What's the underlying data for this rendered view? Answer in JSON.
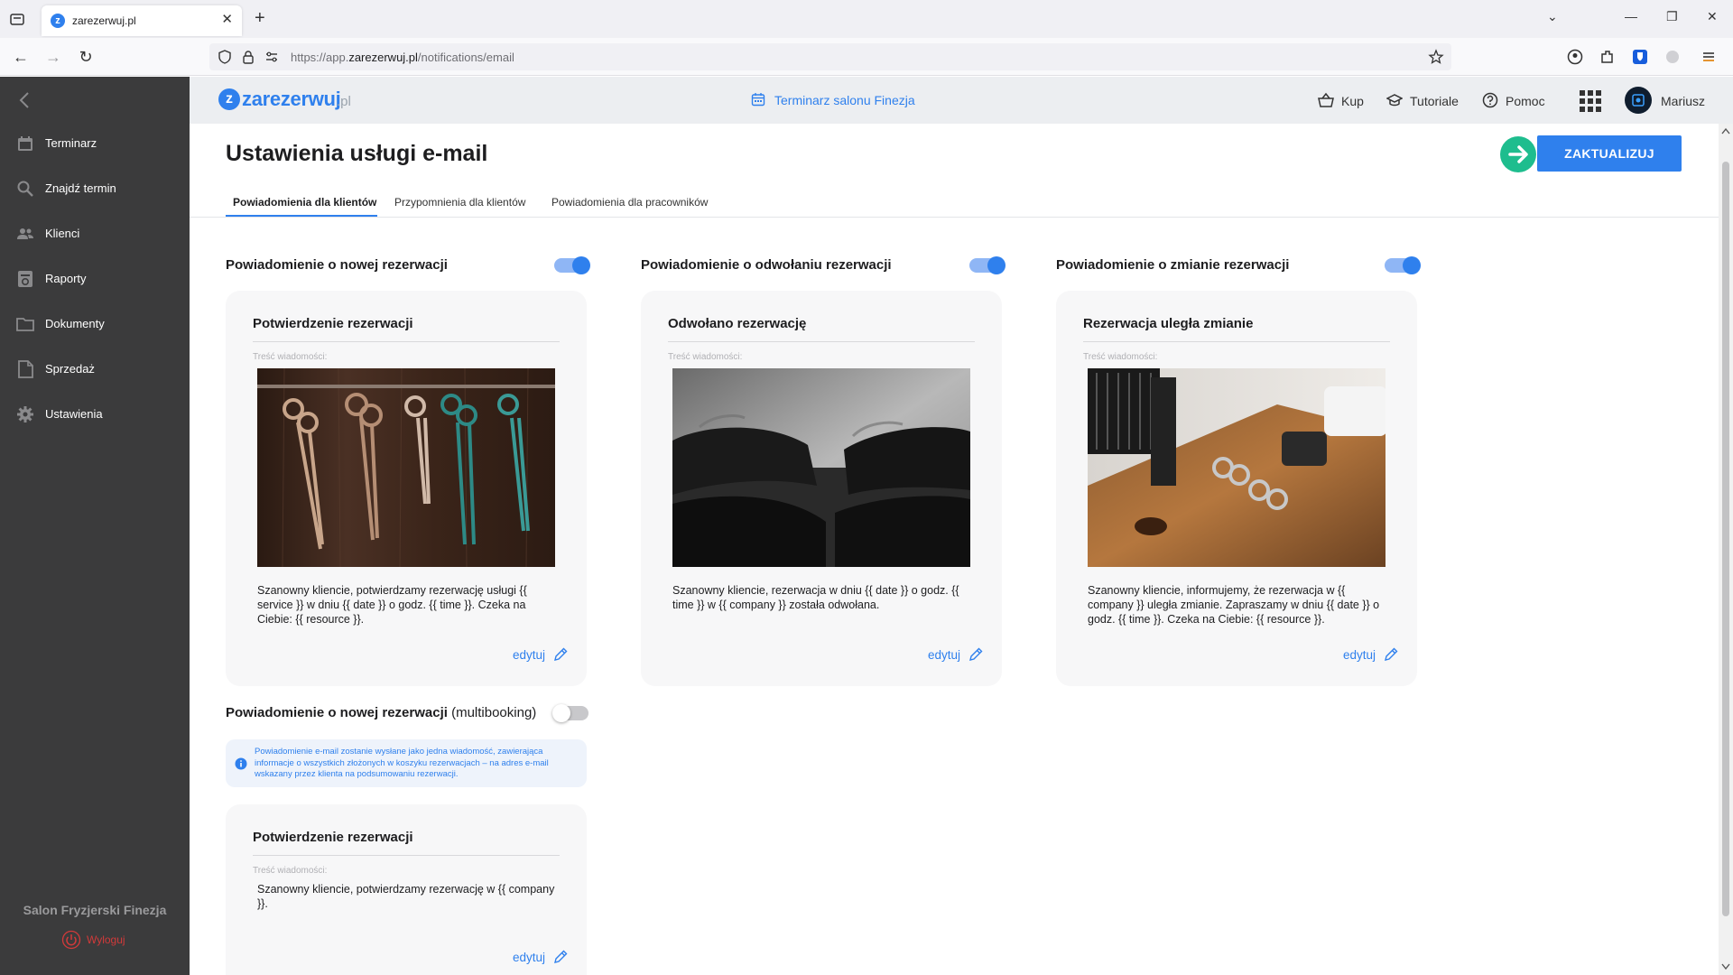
{
  "browser": {
    "tab_title": "zarezerwuj.pl",
    "url_prefix": "https://app.",
    "url_domain": "zarezerwuj.pl",
    "url_path": "/notifications/email"
  },
  "sidebar": {
    "items": [
      {
        "label": "Terminarz",
        "icon": "calendar-icon"
      },
      {
        "label": "Znajdź termin",
        "icon": "search-icon"
      },
      {
        "label": "Klienci",
        "icon": "users-icon"
      },
      {
        "label": "Raporty",
        "icon": "report-icon"
      },
      {
        "label": "Dokumenty",
        "icon": "folder-icon"
      },
      {
        "label": "Sprzedaż",
        "icon": "document-icon"
      },
      {
        "label": "Ustawienia",
        "icon": "gear-icon"
      }
    ],
    "salon_name": "Salon Fryzjerski Finezja",
    "logout_label": "Wyloguj"
  },
  "header": {
    "logo_word": "zarezerwuj",
    "logo_domain": ".pl",
    "calendar_link": "Terminarz salonu Finezja",
    "buy_label": "Kup",
    "tutorials_label": "Tutoriale",
    "help_label": "Pomoc",
    "user_name": "Mariusz"
  },
  "page": {
    "title": "Ustawienia usługi e-mail",
    "update_button": "ZAKTUALIZUJ",
    "tabs": [
      {
        "label": "Powiadomienia dla klientów",
        "active": true
      },
      {
        "label": "Przypomnienia dla klientów",
        "active": false
      },
      {
        "label": "Powiadomienia dla pracowników",
        "active": false
      }
    ]
  },
  "sections": [
    {
      "title": "Powiadomienie o nowej rezerwacji",
      "enabled": true,
      "card_title": "Potwierdzenie rezerwacji",
      "content_label": "Treść wiadomości:",
      "image": "scissors-photo",
      "message": "Szanowny kliencie,  potwierdzamy rezerwację usługi {{ service }}  w dniu {{ date }} o godz. {{ time }}. Czeka na Ciebie: {{ resource }}.",
      "edit_label": "edytuj"
    },
    {
      "title": "Powiadomienie o odwołaniu rezerwacji",
      "enabled": true,
      "card_title": "Odwołano rezerwację",
      "content_label": "Treść wiadomości:",
      "image": "salon-chairs-photo",
      "message": "Szanowny kliencie,  rezerwacja w dniu {{ date }} o godz. {{ time }} w {{ company }} została odwołana.",
      "edit_label": "edytuj"
    },
    {
      "title": "Powiadomienie o zmianie rezerwacji",
      "enabled": true,
      "card_title": "Rezerwacja uległa zmianie",
      "content_label": "Treść wiadomości:",
      "image": "barber-tools-photo",
      "message": "Szanowny kliencie,  informujemy, że rezerwacja w {{ company }} uległa zmianie. Zapraszamy w dniu {{ date }} o godz. {{ time }}. Czeka na Ciebie: {{ resource }}.",
      "edit_label": "edytuj"
    }
  ],
  "multibooking": {
    "title_bold": "Powiadomienie o nowej rezerwacji",
    "title_light": " (multibooking)",
    "enabled": false,
    "info": "Powiadomienie e-mail zostanie wysłane jako jedna wiadomość, zawierająca informacje o wszystkich złożonych w koszyku rezerwacjach – na adres e-mail wskazany przez klienta na podsumowaniu rezerwacji.",
    "card_title": "Potwierdzenie rezerwacji",
    "content_label": "Treść wiadomości:",
    "message": "Szanowny kliencie, potwierdzamy rezerwację w {{ company }}.",
    "edit_label": "edytuj"
  },
  "colors": {
    "accent": "#2f80ed",
    "sidebar": "#3b3b3c",
    "success": "#1ebd8e",
    "logout": "#d23a3a"
  }
}
